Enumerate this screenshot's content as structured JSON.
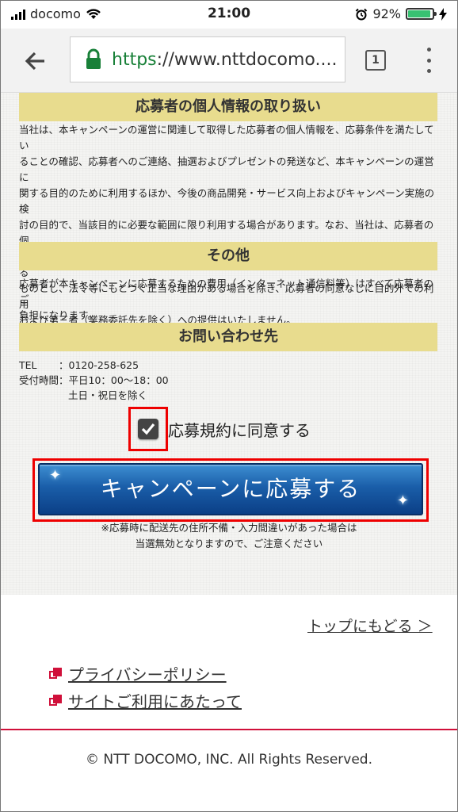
{
  "status_bar": {
    "carrier": "docomo",
    "time": "21:00",
    "battery_percent": "92%",
    "battery_level": 0.92
  },
  "browser": {
    "url_scheme": "https",
    "url_rest": "://www.nttdocomo....",
    "tab_count": "1"
  },
  "sections": {
    "privacy": {
      "heading": "応募者の個人情報の取り扱い",
      "lines": [
        "当社は、本キャンペーンの運営に関連して取得した応募者の個人情報を、応募条件を満たしてい",
        "ることの確認、応募者へのご連絡、抽選およびプレゼントの発送など、本キャンペーンの運営に",
        "関する目的のために利用するほか、今後の商品開発・サービス向上およびキャンペーン実施の検",
        "討の目的で、当該目的に必要な範囲に限り利用する場合があります。なお、当社は、応募者の個",
        "人情報の流出・漏えいの防止、その他個人情報の安全管理のために必要かつ適切な処置を講じる",
        "ものとし、法令等にもとづく正当な理由がある場合を除き、応募者の同意なしに目的外での利用",
        "および第三者（業務委託先を除く）への提供はいたしません。"
      ]
    },
    "other": {
      "heading": "その他",
      "lines": [
        "応募者が本キャンペーンに応募するための費用（インターネット通信料等）はすべて応募者のご",
        "負担になります。"
      ]
    },
    "contact": {
      "heading": "お問い合わせ先",
      "tel_label": "TEL",
      "tel_value": "：0120-258-625",
      "hours_label": "受付時間",
      "hours_value": "：平日10：00〜18：00",
      "hours_note": "土日・祝日を除く"
    }
  },
  "form": {
    "agree_label": "応募規約に同意する",
    "agree_checked": true,
    "apply_button": "キャンペーンに応募する",
    "notice_lines": [
      "※応募時に配送先の住所不備・入力間違いがあった場合は",
      "当選無効となりますので、ご注意ください"
    ]
  },
  "footer": {
    "back_to_top": "トップにもどる ＞",
    "links": [
      "プライバシーポリシー",
      "サイトご利用にあたって"
    ],
    "copyright": "© NTT DOCOMO, INC. All Rights Reserved."
  },
  "colors": {
    "section_heading_bg": "#e8dc8e",
    "button_blue": "#1a5ea9",
    "highlight_red": "#e00000",
    "link_red": "#d0103a"
  }
}
